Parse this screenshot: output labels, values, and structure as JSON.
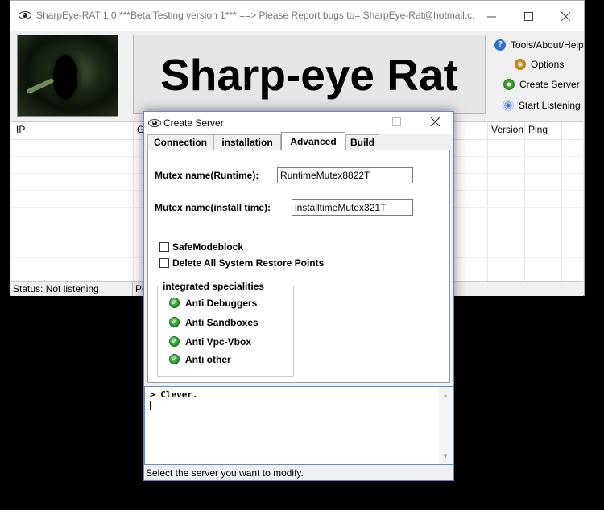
{
  "main_window": {
    "title": "SharpEye-RAT 1.0  ***Beta Testing version 1*** ==> Please Report bugs to= SharpEye-Rat@hotmail.c...",
    "banner_title": "Sharp-eye Rat",
    "side_buttons": {
      "tools": "Tools/About/Help",
      "options": "Options",
      "create_server": "Create Server",
      "start_listening": "Start Listening"
    },
    "columns": {
      "ip": "IP",
      "g": "G",
      "version": "Version",
      "ping": "Ping"
    },
    "status_text": "Status: Not listening",
    "status_secondary": "Po"
  },
  "dialog": {
    "title": "Create Server",
    "tabs": [
      "Connection",
      "installation",
      "Advanced",
      "Build"
    ],
    "active_tab": "Advanced",
    "mutex_runtime_label": "Mutex name(Runtime):",
    "mutex_runtime_value": "RuntimeMutex8822T",
    "mutex_install_label": "Mutex name(install time):",
    "mutex_install_value": "installtimeMutex321T",
    "safemode_label": "SafeModeblock",
    "delete_restore_label": "Delete All System Restore Points",
    "group_title": "integrated specialities",
    "specialities": [
      "Anti Debuggers",
      "Anti Sandboxes",
      "Anti Vpc-Vbox",
      "Anti other"
    ],
    "console_text": "> Clever.",
    "status_text": "Select the server you want to modify."
  },
  "colors": {
    "title_text": "#777777",
    "accent_border": "#5a8fd8",
    "green_check": "#2f9c2f"
  }
}
